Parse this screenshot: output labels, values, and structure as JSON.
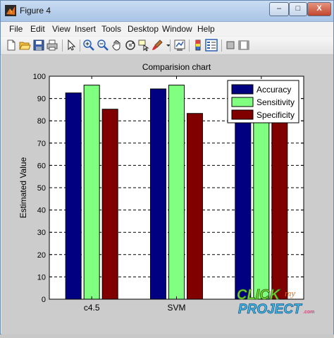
{
  "window": {
    "title": "Figure 4",
    "buttons": {
      "minimize": "–",
      "maximize": "□",
      "close": "X"
    }
  },
  "menu": [
    {
      "name": "menu-file",
      "label": "File"
    },
    {
      "name": "menu-edit",
      "label": "Edit"
    },
    {
      "name": "menu-view",
      "label": "View"
    },
    {
      "name": "menu-insert",
      "label": "Insert"
    },
    {
      "name": "menu-tools",
      "label": "Tools"
    },
    {
      "name": "menu-desktop",
      "label": "Desktop"
    },
    {
      "name": "menu-window",
      "label": "Window"
    },
    {
      "name": "menu-help",
      "label": "Help"
    }
  ],
  "toolbar": [
    {
      "name": "new-figure-icon"
    },
    {
      "name": "open-file-icon"
    },
    {
      "name": "save-icon"
    },
    {
      "name": "print-icon"
    },
    {
      "name": "edit-plot-arrow-icon"
    },
    {
      "name": "zoom-in-icon"
    },
    {
      "name": "zoom-out-icon"
    },
    {
      "name": "pan-hand-icon"
    },
    {
      "name": "rotate-3d-icon"
    },
    {
      "name": "data-cursor-icon"
    },
    {
      "name": "brush-icon"
    },
    {
      "name": "link-plot-icon"
    },
    {
      "name": "colorbar-icon"
    },
    {
      "name": "legend-icon"
    },
    {
      "name": "hide-plot-tools-icon"
    },
    {
      "name": "show-plot-tools-icon"
    }
  ],
  "chart_data": {
    "type": "bar",
    "title": "Comparision chart",
    "xlabel": "",
    "ylabel": "Estimated Value",
    "categories": [
      "c4.5",
      "SVM",
      ""
    ],
    "series": [
      {
        "name": "Accuracy",
        "color": "#000080",
        "values": [
          92.5,
          94.3,
          85
        ]
      },
      {
        "name": "Sensitivity",
        "color": "#80ff80",
        "values": [
          96,
          96,
          85
        ]
      },
      {
        "name": "Specificity",
        "color": "#800000",
        "values": [
          85.2,
          83.3,
          85
        ]
      }
    ],
    "ylim": [
      0,
      100
    ],
    "yticks": [
      0,
      10,
      20,
      30,
      40,
      50,
      60,
      70,
      80,
      90,
      100
    ],
    "grid": "y-dashed",
    "legend_position": "top-right"
  },
  "watermark": {
    "line1": "CLICK",
    "line2": "my",
    "line3": "PROJECT",
    "suffix": ".com"
  }
}
